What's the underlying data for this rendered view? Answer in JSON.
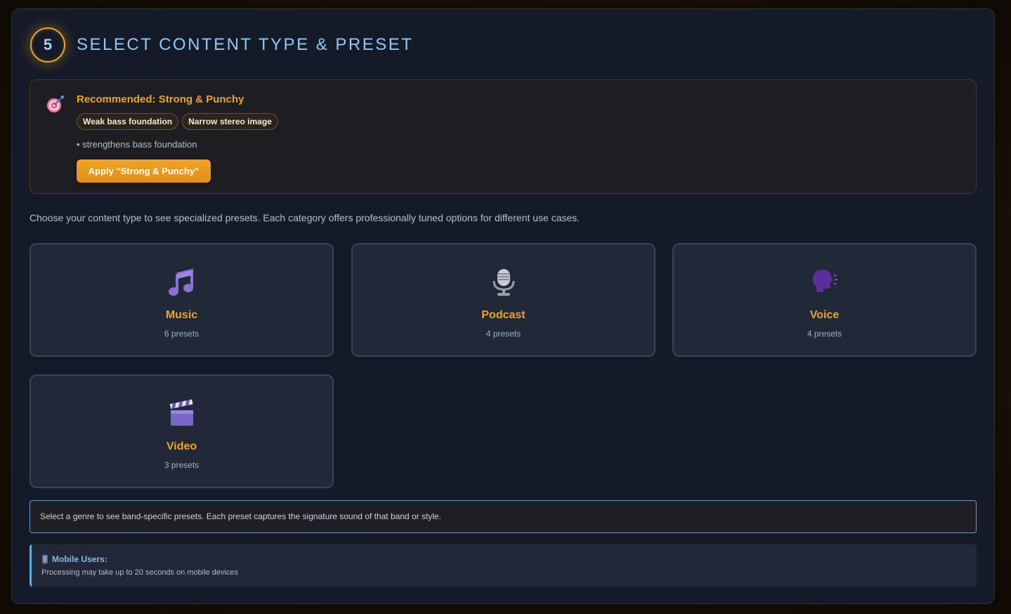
{
  "header": {
    "step_number": "5",
    "title": "SELECT CONTENT TYPE & PRESET"
  },
  "recommendation": {
    "icon": "target-icon",
    "title": "Recommended: Strong & Punchy",
    "tags": [
      "Weak bass foundation",
      "Narrow stereo image"
    ],
    "note": "• strengthens bass foundation",
    "apply_label": "Apply \"Strong & Punchy\""
  },
  "intro_text": "Choose your content type to see specialized presets. Each category offers professionally tuned options for different use cases.",
  "content_types": [
    {
      "name": "Music",
      "count": "6 presets",
      "icon": "music-note-icon"
    },
    {
      "name": "Podcast",
      "count": "4 presets",
      "icon": "microphone-icon"
    },
    {
      "name": "Voice",
      "count": "4 presets",
      "icon": "speaking-head-icon"
    },
    {
      "name": "Video",
      "count": "3 presets",
      "icon": "clapperboard-icon"
    }
  ],
  "genre_hint": "Select a genre to see band-specific presets. Each preset captures the signature sound of that band or style.",
  "mobile_notice": {
    "icon": "mobile-phone-icon",
    "title": "Mobile Users:",
    "text": "Processing may take up to 20 seconds on mobile devices"
  },
  "colors": {
    "accent": "#f0a423",
    "title_blue": "#8fcaf4",
    "panel_bg": "#151a28",
    "card_bg": "#212838"
  }
}
